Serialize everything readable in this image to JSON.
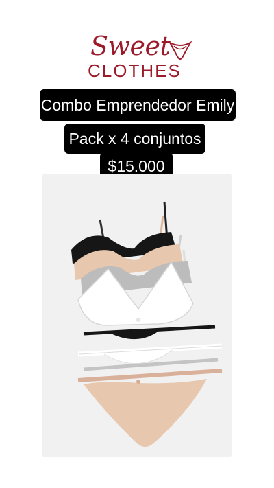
{
  "brand": {
    "script": "Sweet",
    "sub": "CLOTHES",
    "color": "#9b1b2a"
  },
  "headline": "Combo Emprendedor Emily",
  "pack": "Pack x 4 conjuntos",
  "price": "$15.000",
  "product_colors": [
    "#111111",
    "#e7c7ad",
    "#b8b8b8",
    "#ffffff"
  ]
}
